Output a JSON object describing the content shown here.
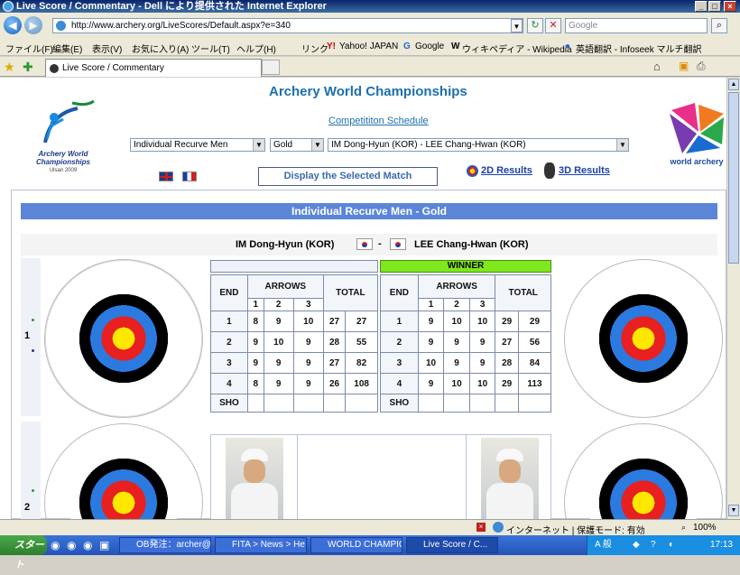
{
  "window": {
    "title": "Live Score / Commentary - Dell により提供された Internet Explorer",
    "buttons": [
      "_",
      "□",
      "×"
    ]
  },
  "toolbar": {
    "address": "http://www.archery.org/LiveScores/Default.aspx?e=340",
    "search_placeholder": "Google"
  },
  "menu": {
    "items": [
      "ファイル(F)",
      "編集(E)",
      "表示(V)",
      "お気に入り(A)",
      "ツール(T)",
      "ヘルプ(H)"
    ],
    "links_label": "リンク",
    "links": [
      "Yahoo! JAPAN",
      "Google",
      "ウィキペディア - Wikipedia",
      "英語翻訳 - Infoseek マルチ翻訳"
    ]
  },
  "tab": {
    "label": "Live Score / Commentary"
  },
  "page": {
    "title": "Archery World Championships",
    "schedule_link": "Competititon Schedule",
    "logo_text": "Archery World Championships",
    "logo_sub": "Ulsan 2009",
    "brand": "world archery",
    "event_select": "Individual Recurve Men",
    "medal_select": "Gold",
    "match_select": "IM Dong-Hyun (KOR) - LEE Chang-Hwan (KOR)",
    "display_button": "Display the Selected Match",
    "results_2d": "2D Results",
    "results_3d": "3D Results",
    "match_header": "Individual Recurve Men - Gold",
    "player1": "IM Dong-Hyun (KOR)",
    "player2": "LEE Chang-Hwan (KOR)",
    "vs": "-",
    "row1_label": "1",
    "row2_label": "2",
    "winner_label": "WINNER",
    "headers": {
      "end": "END",
      "arrows": "ARROWS",
      "total": "TOTAL",
      "a1": "1",
      "a2": "2",
      "a3": "3",
      "sho": "SHO"
    },
    "colors": {
      "header_blue": "#5b86d8",
      "winner_green": "#7ee81c",
      "title_blue": "#1d6fae"
    }
  },
  "scores": {
    "left": [
      {
        "end": "1",
        "a": [
          "8",
          "9",
          "10"
        ],
        "end_total": "27",
        "running": "27"
      },
      {
        "end": "2",
        "a": [
          "9",
          "10",
          "9"
        ],
        "end_total": "28",
        "running": "55"
      },
      {
        "end": "3",
        "a": [
          "9",
          "9",
          "9"
        ],
        "end_total": "27",
        "running": "82"
      },
      {
        "end": "4",
        "a": [
          "8",
          "9",
          "9"
        ],
        "end_total": "26",
        "running": "108"
      }
    ],
    "right": [
      {
        "end": "1",
        "a": [
          "9",
          "10",
          "10"
        ],
        "end_total": "29",
        "running": "29"
      },
      {
        "end": "2",
        "a": [
          "9",
          "9",
          "9"
        ],
        "end_total": "27",
        "running": "56"
      },
      {
        "end": "3",
        "a": [
          "10",
          "9",
          "9"
        ],
        "end_total": "28",
        "running": "84"
      },
      {
        "end": "4",
        "a": [
          "9",
          "10",
          "10"
        ],
        "end_total": "29",
        "running": "113"
      }
    ]
  },
  "status": {
    "zone": "インターネット | 保護モード: 有効",
    "zoom": "100%"
  },
  "taskbar": {
    "start": "スタート",
    "tasks": [
      "OB発注：archer@...",
      "FITA > News > He...",
      "WORLD CHAMPIO...",
      "Live Score / C..."
    ],
    "clock": "17:13"
  }
}
